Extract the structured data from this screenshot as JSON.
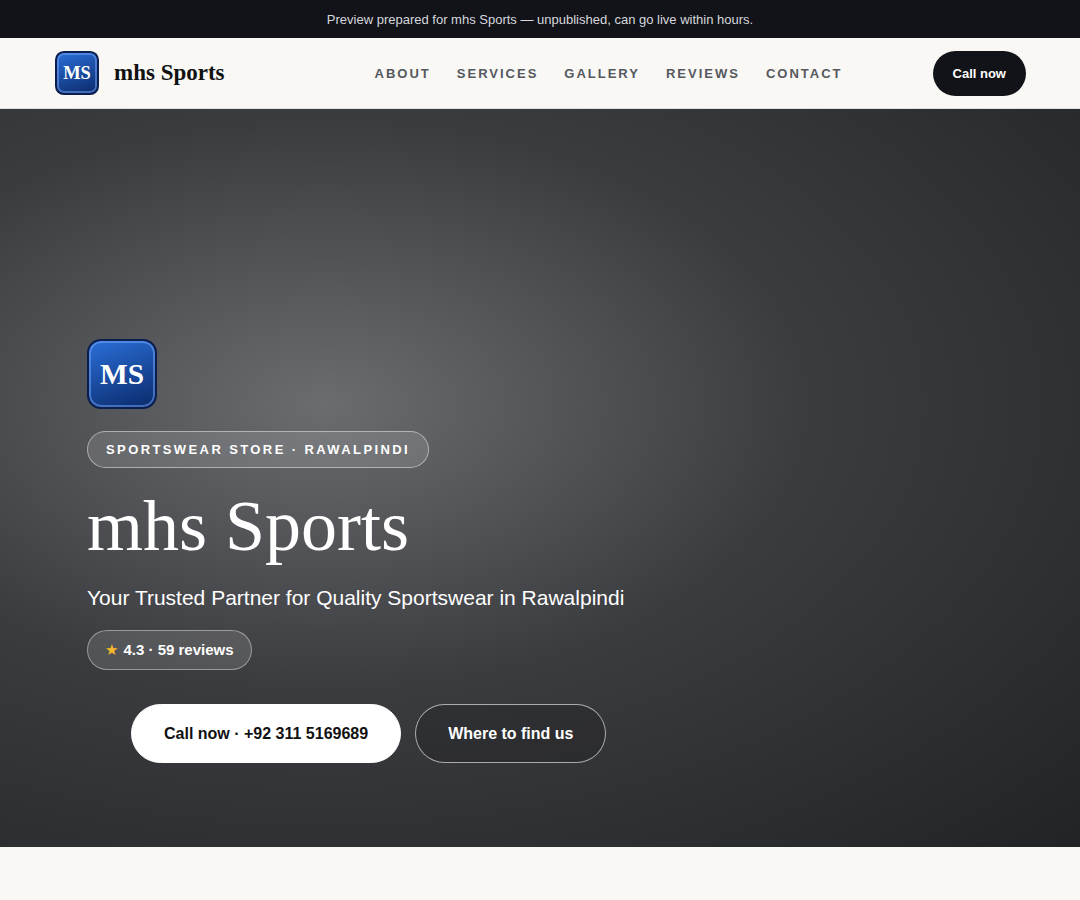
{
  "banner": {
    "text": "Preview prepared for mhs Sports — unpublished, can go live within hours."
  },
  "header": {
    "logo": "MS",
    "brand": "mhs Sports",
    "nav": [
      "ABOUT",
      "SERVICES",
      "GALLERY",
      "REVIEWS",
      "CONTACT"
    ],
    "button": "Call now"
  },
  "hero": {
    "logo": "MS",
    "badge": "SPORTSWEAR STORE · RAWALPINDI",
    "title": "mhs Sports",
    "subtitle": "Your Trusted Partner for Quality Sportswear in Rawalpindi",
    "rating": {
      "icon": "★",
      "text": "4.3 · 59 reviews"
    },
    "buttons": [
      {
        "label": "Call now · +92 311 5169689",
        "kind": "solid"
      },
      {
        "label": "Where to find us",
        "kind": "outline"
      }
    ]
  }
}
